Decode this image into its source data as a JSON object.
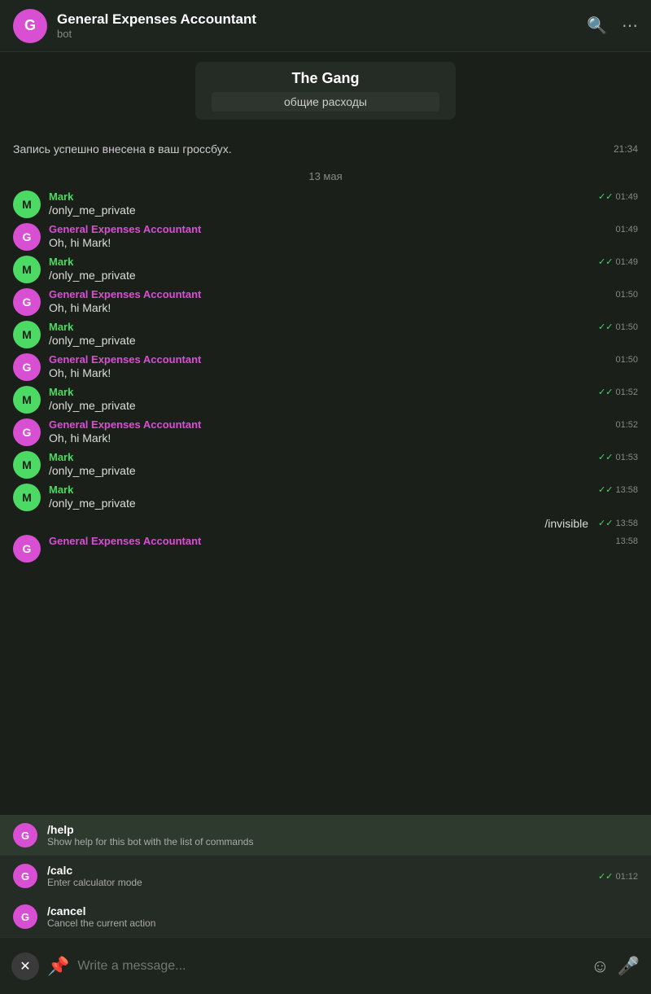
{
  "header": {
    "avatar_letter": "G",
    "title": "General Expenses Accountant",
    "subtitle": "bot",
    "search_icon": "🔍",
    "more_icon": "···"
  },
  "group_card": {
    "name": "The Gang",
    "subname": "общие расходы"
  },
  "system_message": {
    "text": "Запись успешно внесена в ваш гроссбух.",
    "time": "21:34"
  },
  "date_separator": "13 мая",
  "messages": [
    {
      "id": 1,
      "avatar": "M",
      "avatar_color": "green",
      "sender": "Mark",
      "sender_color": "green",
      "text": "/only_me_private",
      "time": "01:49",
      "checked": true,
      "side": "left"
    },
    {
      "id": 2,
      "avatar": "G",
      "avatar_color": "pink",
      "sender": "General Expenses Accountant",
      "sender_color": "pink",
      "text": "Oh, hi Mark!",
      "time": "01:49",
      "checked": false,
      "side": "left"
    },
    {
      "id": 3,
      "avatar": "M",
      "avatar_color": "green",
      "sender": "Mark",
      "sender_color": "green",
      "text": "/only_me_private",
      "time": "01:49",
      "checked": true,
      "side": "left"
    },
    {
      "id": 4,
      "avatar": "G",
      "avatar_color": "pink",
      "sender": "General Expenses Accountant",
      "sender_color": "pink",
      "text": "Oh, hi Mark!",
      "time": "01:50",
      "checked": false,
      "side": "left"
    },
    {
      "id": 5,
      "avatar": "M",
      "avatar_color": "green",
      "sender": "Mark",
      "sender_color": "green",
      "text": "/only_me_private",
      "time": "01:50",
      "checked": true,
      "side": "left"
    },
    {
      "id": 6,
      "avatar": "G",
      "avatar_color": "pink",
      "sender": "General Expenses Accountant",
      "sender_color": "pink",
      "text": "Oh, hi Mark!",
      "time": "01:50",
      "checked": false,
      "side": "left"
    },
    {
      "id": 7,
      "avatar": "M",
      "avatar_color": "green",
      "sender": "Mark",
      "sender_color": "green",
      "text": "/only_me_private",
      "time": "01:52",
      "checked": true,
      "side": "left"
    },
    {
      "id": 8,
      "avatar": "G",
      "avatar_color": "pink",
      "sender": "General Expenses Accountant",
      "sender_color": "pink",
      "text": "Oh, hi Mark!",
      "time": "01:52",
      "checked": false,
      "side": "left"
    },
    {
      "id": 9,
      "avatar": "M",
      "avatar_color": "green",
      "sender": "Mark",
      "sender_color": "green",
      "text": "/only_me_private",
      "time": "01:53",
      "checked": true,
      "side": "left"
    },
    {
      "id": 10,
      "avatar": "M",
      "avatar_color": "green",
      "sender": "Mark",
      "sender_color": "green",
      "text": "/only_me_private",
      "time": "13:58",
      "checked": true,
      "side": "left"
    },
    {
      "id": 11,
      "text": "/invisible",
      "time": "13:58",
      "checked": true,
      "side": "right"
    },
    {
      "id": 12,
      "avatar": "G",
      "avatar_color": "pink",
      "sender": "General Expenses Accountant",
      "sender_color": "pink",
      "text": "",
      "time": "13:58",
      "checked": false,
      "side": "left"
    }
  ],
  "commands": [
    {
      "id": "help",
      "avatar": "G",
      "name": "/help",
      "desc": "Show help for this bot with the list of commands",
      "time": "",
      "active": true
    },
    {
      "id": "calc",
      "avatar": "G",
      "name": "/calc",
      "desc": "Enter calculator mode",
      "time": "✓✓ 01:12",
      "active": false
    },
    {
      "id": "cancel",
      "avatar": "G",
      "name": "/cancel",
      "desc": "Cancel the current action",
      "time": "",
      "active": false
    }
  ],
  "bottom_bar": {
    "close_label": "✕",
    "attach_icon": "📎",
    "placeholder": "Write a message...",
    "emoji_icon": "☺",
    "mic_icon": "🎤"
  }
}
